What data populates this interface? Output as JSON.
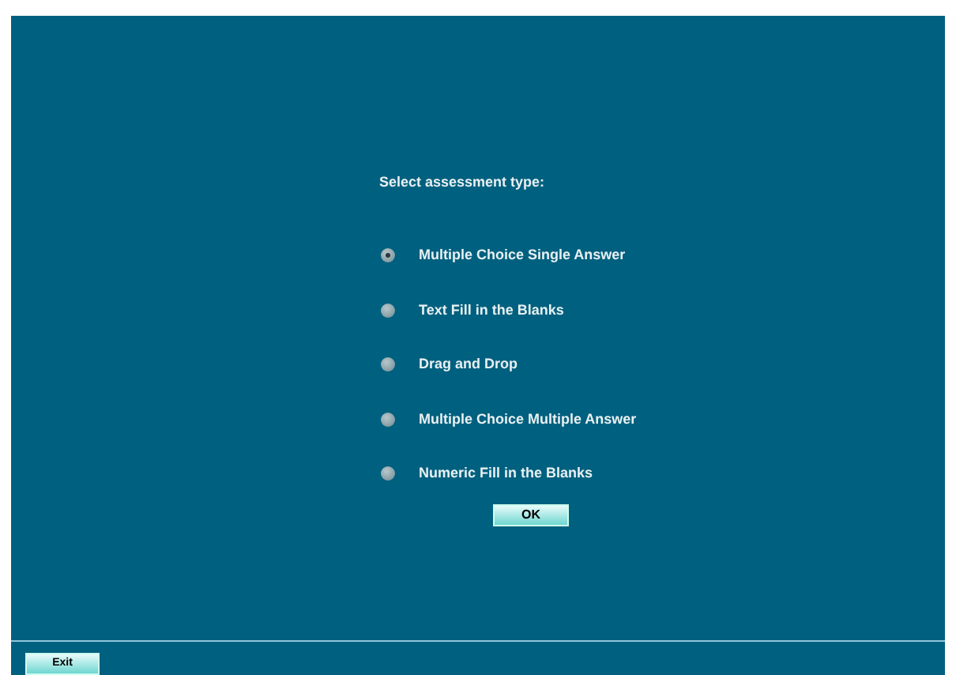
{
  "prompt": "Select assessment type:",
  "options": [
    {
      "label": "Multiple Choice Single Answer",
      "selected": true
    },
    {
      "label": "Text Fill in the Blanks",
      "selected": false
    },
    {
      "label": "Drag and Drop",
      "selected": false
    },
    {
      "label": "Multiple Choice Multiple Answer",
      "selected": false
    },
    {
      "label": "Numeric Fill in the Blanks",
      "selected": false
    }
  ],
  "ok_button": "OK",
  "exit_button": "Exit"
}
